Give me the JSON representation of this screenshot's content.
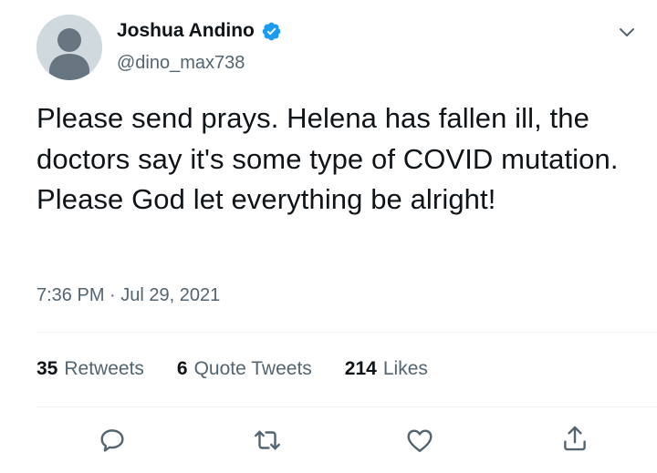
{
  "author": {
    "display_name": "Joshua Andino",
    "handle": "@dino_max738",
    "verified": true
  },
  "tweet": {
    "text": "Please send prays. Helena has fallen ill, the doctors say it's some type of COVID mutation. Please God let everything be alright!",
    "time": "7:36 PM",
    "separator": "·",
    "date": "Jul 29, 2021"
  },
  "stats": {
    "retweets_count": "35",
    "retweets_label": "Retweets",
    "quotes_count": "6",
    "quotes_label": "Quote Tweets",
    "likes_count": "214",
    "likes_label": "Likes"
  },
  "icons": {
    "menu": "chevron-down-icon",
    "reply": "reply-icon",
    "retweet": "retweet-icon",
    "like": "heart-icon",
    "share": "share-icon"
  },
  "colors": {
    "verified": "#1d9bf0",
    "icon": "#536471",
    "text": "#0f1419"
  }
}
